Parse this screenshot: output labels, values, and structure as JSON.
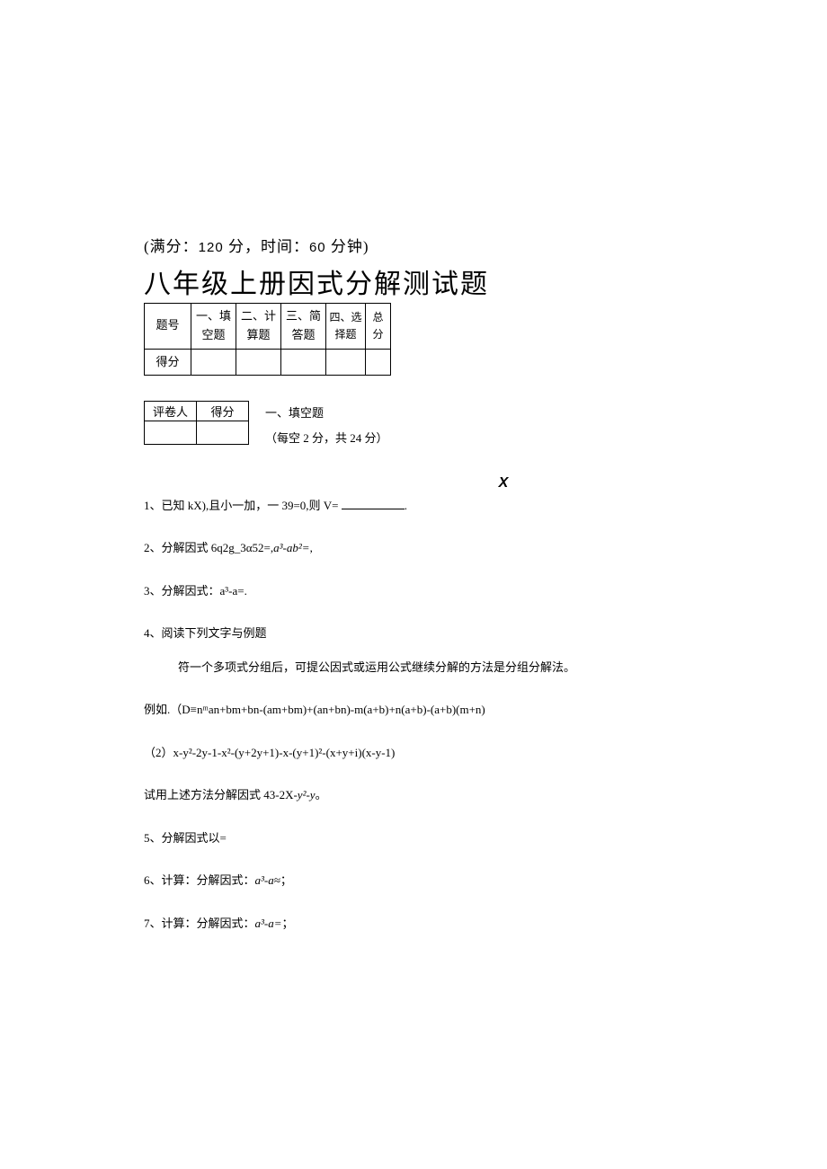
{
  "header": {
    "meta_prefix": "(满分：",
    "meta_full": "120",
    "meta_mid": " 分，时间：",
    "meta_time": "60",
    "meta_suffix": " 分钟)",
    "title": "八年级上册因式分解测试题"
  },
  "score_table": {
    "col0": "题号",
    "col1": "一、填空题",
    "col2": "二、计算题",
    "col3": "三、简答题",
    "col4": "四、选择题",
    "col5": "总分",
    "row_label": "得分"
  },
  "grader_table": {
    "c0": "评卷人",
    "c1": "得分"
  },
  "section1": {
    "heading": "一、填空题",
    "sub": "（每空 2 分，共 24 分）"
  },
  "xmark": "X",
  "q1": "1、已知 kX),且小一加，一 39=0,则 V=",
  "q1_tail": ".",
  "q2_a": "2、分解因式 6q2g_3α52=,",
  "q2_b": "a³-ab²=",
  "q2_c": ",",
  "q3_a": "3、分解因式：a",
  "q3_b": "³-a=.",
  "q4": "4、阅读下列文字与例题",
  "q4_body": "符一个多项式分组后，可提公因式或运用公式继续分解的方法是分组分解法。",
  "q4_ex1": "例如.（D≡nᵐan+bm+bn-(am+bm)+(an+bn)-m(a+b)+n(a+b)-(a+b)(m+n)",
  "q4_ex2": "（2）x-y²-2y-1-x²-(y+2y+1)-x-(y+1)²-(x+y+i)(x-y-1)",
  "q4_try_a": "试用上述方法分解因式 43-2X-",
  "q4_try_b": "y²-y",
  "q4_try_c": "。",
  "q5": "5、分解因式以=",
  "q6_a": "6、计算：分解因式：",
  "q6_b": "a³-a≈",
  "q6_c": "；",
  "q7_a": "7、计算：分解因式：",
  "q7_b": "a³-a=",
  "q7_c": "；"
}
